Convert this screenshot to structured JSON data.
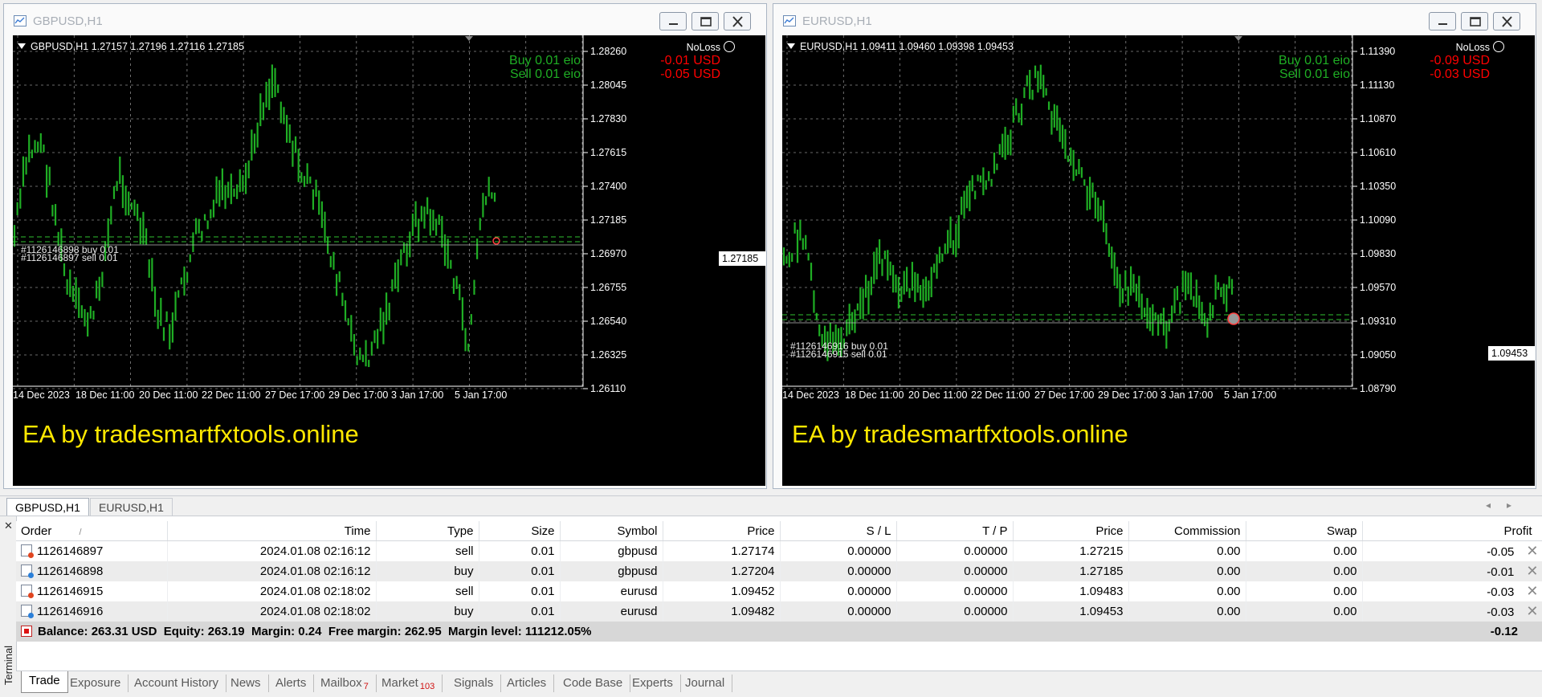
{
  "windows": [
    {
      "title": "GBPUSD,H1",
      "ohlc": "GBPUSD,H1  1.27157 1.27196 1.27116 1.27185",
      "noloss": "NoLoss",
      "buy_label": "Buy 0.01 eio",
      "buy_value": "-0.01 USD",
      "sell_label": "Sell 0.01 eio",
      "sell_value": "-0.05 USD",
      "ea_text": "EA by tradesmartfxtools.online",
      "order_buy_label": "#1126146898 buy 0.01",
      "order_sell_label": "#1126146897 sell 0.01",
      "current_price": "1.27185",
      "price_ticks": [
        "1.28260",
        "1.28045",
        "1.27830",
        "1.27615",
        "1.27400",
        "1.27185",
        "1.26970",
        "1.26755",
        "1.26540",
        "1.26325",
        "1.26110"
      ],
      "time_ticks": [
        "14 Dec 2023",
        "18 Dec 11:00",
        "20 Dec 11:00",
        "22 Dec 11:00",
        "27 Dec 17:00",
        "29 Dec 17:00",
        "3 Jan 17:00",
        "5 Jan 17:00"
      ],
      "series_color": "#1fae24"
    },
    {
      "title": "EURUSD,H1",
      "ohlc": "EURUSD,H1  1.09411 1.09460 1.09398 1.09453",
      "noloss": "NoLoss",
      "buy_label": "Buy 0.01 eio",
      "buy_value": "-0.09 USD",
      "sell_label": "Sell 0.01 eio",
      "sell_value": "-0.03 USD",
      "ea_text": "EA by tradesmartfxtools.online",
      "order_buy_label": "#1126146916 buy 0.01",
      "order_sell_label": "#1126146915 sell 0.01",
      "current_price": "1.09453",
      "price_ticks": [
        "1.11390",
        "1.11130",
        "1.10870",
        "1.10610",
        "1.10350",
        "1.10090",
        "1.09830",
        "1.09570",
        "1.09310",
        "1.09050",
        "1.08790"
      ],
      "time_ticks": [
        "14 Dec 2023",
        "18 Dec 11:00",
        "20 Dec 11:00",
        "22 Dec 11:00",
        "27 Dec 17:00",
        "29 Dec 17:00",
        "3 Jan 17:00",
        "5 Jan 17:00"
      ],
      "series_color": "#1fae24"
    }
  ],
  "chart_tabs": [
    "GBPUSD,H1",
    "EURUSD,H1"
  ],
  "terminal": {
    "side_label": "Terminal",
    "columns": [
      "Order",
      "Time",
      "Type",
      "Size",
      "Symbol",
      "Price",
      "S / L",
      "T / P",
      "Price",
      "Commission",
      "Swap",
      "Profit"
    ],
    "sort_marker": "/",
    "rows": [
      {
        "order": "1126146897",
        "time": "2024.01.08 02:16:12",
        "type": "sell",
        "size": "0.01",
        "symbol": "gbpusd",
        "price": "1.27174",
        "sl": "0.00000",
        "tp": "0.00000",
        "cur_price": "1.27215",
        "commission": "0.00",
        "swap": "0.00",
        "profit": "-0.05"
      },
      {
        "order": "1126146898",
        "time": "2024.01.08 02:16:12",
        "type": "buy",
        "size": "0.01",
        "symbol": "gbpusd",
        "price": "1.27204",
        "sl": "0.00000",
        "tp": "0.00000",
        "cur_price": "1.27185",
        "commission": "0.00",
        "swap": "0.00",
        "profit": "-0.01"
      },
      {
        "order": "1126146915",
        "time": "2024.01.08 02:18:02",
        "type": "sell",
        "size": "0.01",
        "symbol": "eurusd",
        "price": "1.09452",
        "sl": "0.00000",
        "tp": "0.00000",
        "cur_price": "1.09483",
        "commission": "0.00",
        "swap": "0.00",
        "profit": "-0.03"
      },
      {
        "order": "1126146916",
        "time": "2024.01.08 02:18:02",
        "type": "buy",
        "size": "0.01",
        "symbol": "eurusd",
        "price": "1.09482",
        "sl": "0.00000",
        "tp": "0.00000",
        "cur_price": "1.09453",
        "commission": "0.00",
        "swap": "0.00",
        "profit": "-0.03"
      }
    ],
    "summary": "Balance: 263.31 USD  Equity: 263.19  Margin: 0.24  Free margin: 262.95  Margin level: 111212.05%",
    "summary_profit": "-0.12",
    "tabs": [
      {
        "label": "Trade",
        "badge": ""
      },
      {
        "label": "Exposure",
        "badge": ""
      },
      {
        "label": "Account History",
        "badge": ""
      },
      {
        "label": "News",
        "badge": ""
      },
      {
        "label": "Alerts",
        "badge": ""
      },
      {
        "label": "Mailbox",
        "badge": "7"
      },
      {
        "label": "Market",
        "badge": "103"
      },
      {
        "label": "Signals",
        "badge": ""
      },
      {
        "label": "Articles",
        "badge": ""
      },
      {
        "label": "Code Base",
        "badge": ""
      },
      {
        "label": "Experts",
        "badge": ""
      },
      {
        "label": "Journal",
        "badge": ""
      }
    ]
  },
  "colors": {
    "chart_background": "#000000",
    "candle": "#1fae24",
    "ea_text": "#ffe800",
    "loss": "#ff0000",
    "grid": "#8a8a8a"
  }
}
